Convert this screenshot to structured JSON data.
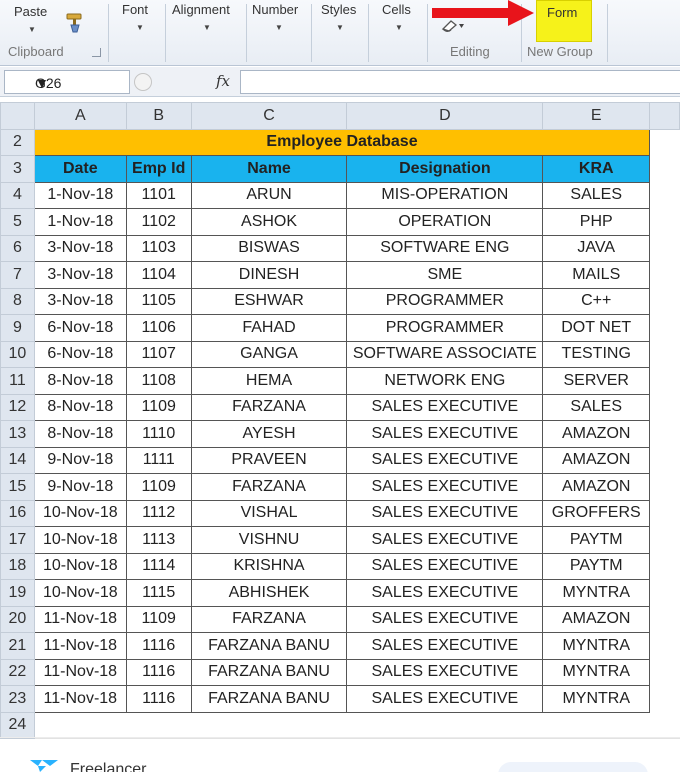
{
  "ribbon": {
    "paste_label": "Paste",
    "font_label": "Font",
    "alignment_label": "Alignment",
    "number_label": "Number",
    "styles_label": "Styles",
    "cells_label": "Cells",
    "clipboard_group": "Clipboard",
    "editing_group": "Editing",
    "form_label": "Form",
    "new_group": "New Group",
    "icons": [
      "format-painter-icon",
      "dialog-launcher-icon",
      "clear-icon",
      "red-arrow-icon"
    ],
    "arrow_color": "#e8141b",
    "form_highlight": "#f6f21a"
  },
  "formula_bar": {
    "cell_ref": "G26",
    "fx_label": "fx",
    "value": ""
  },
  "sheet": {
    "columns": [
      "A",
      "B",
      "C",
      "D",
      "E"
    ],
    "title_row_num": "2",
    "title": "Employee Database",
    "header_row_num": "3",
    "headers": [
      "Date",
      "Emp Id",
      "Name",
      "Designation",
      "KRA"
    ],
    "rows": [
      {
        "num": "4",
        "cells": [
          "1-Nov-18",
          "1101",
          "ARUN",
          "MIS-OPERATION",
          "SALES"
        ]
      },
      {
        "num": "5",
        "cells": [
          "1-Nov-18",
          "1102",
          "ASHOK",
          "OPERATION",
          "PHP"
        ]
      },
      {
        "num": "6",
        "cells": [
          "3-Nov-18",
          "1103",
          "BISWAS",
          "SOFTWARE ENG",
          "JAVA"
        ]
      },
      {
        "num": "7",
        "cells": [
          "3-Nov-18",
          "1104",
          "DINESH",
          "SME",
          "MAILS"
        ]
      },
      {
        "num": "8",
        "cells": [
          "3-Nov-18",
          "1105",
          "ESHWAR",
          "PROGRAMMER",
          "C++"
        ]
      },
      {
        "num": "9",
        "cells": [
          "6-Nov-18",
          "1106",
          "FAHAD",
          "PROGRAMMER",
          "DOT NET"
        ]
      },
      {
        "num": "10",
        "cells": [
          "6-Nov-18",
          "1107",
          "GANGA",
          "SOFTWARE ASSOCIATE",
          "TESTING"
        ]
      },
      {
        "num": "11",
        "cells": [
          "8-Nov-18",
          "1108",
          "HEMA",
          "NETWORK ENG",
          "SERVER"
        ]
      },
      {
        "num": "12",
        "cells": [
          "8-Nov-18",
          "1109",
          "FARZANA",
          "SALES EXECUTIVE",
          "SALES"
        ]
      },
      {
        "num": "13",
        "cells": [
          "8-Nov-18",
          "1110",
          "AYESH",
          "SALES EXECUTIVE",
          "AMAZON"
        ]
      },
      {
        "num": "14",
        "cells": [
          "9-Nov-18",
          "1111",
          "PRAVEEN",
          "SALES EXECUTIVE",
          "AMAZON"
        ]
      },
      {
        "num": "15",
        "cells": [
          "9-Nov-18",
          "1109",
          "FARZANA",
          "SALES EXECUTIVE",
          "AMAZON"
        ]
      },
      {
        "num": "16",
        "cells": [
          "10-Nov-18",
          "1112",
          "VISHAL",
          "SALES EXECUTIVE",
          "GROFFERS"
        ]
      },
      {
        "num": "17",
        "cells": [
          "10-Nov-18",
          "1113",
          "VISHNU",
          "SALES EXECUTIVE",
          "PAYTM"
        ]
      },
      {
        "num": "18",
        "cells": [
          "10-Nov-18",
          "1114",
          "KRISHNA",
          "SALES EXECUTIVE",
          "PAYTM"
        ]
      },
      {
        "num": "19",
        "cells": [
          "10-Nov-18",
          "1115",
          "ABHISHEK",
          "SALES EXECUTIVE",
          "MYNTRA"
        ]
      },
      {
        "num": "20",
        "cells": [
          "11-Nov-18",
          "1109",
          "FARZANA",
          "SALES EXECUTIVE",
          "AMAZON"
        ]
      },
      {
        "num": "21",
        "cells": [
          "11-Nov-18",
          "1116",
          "FARZANA BANU",
          "SALES EXECUTIVE",
          "MYNTRA"
        ]
      },
      {
        "num": "22",
        "cells": [
          "11-Nov-18",
          "1116",
          "FARZANA BANU",
          "SALES EXECUTIVE",
          "MYNTRA"
        ]
      },
      {
        "num": "23",
        "cells": [
          "11-Nov-18",
          "1116",
          "FARZANA BANU",
          "SALES EXECUTIVE",
          "MYNTRA"
        ]
      }
    ],
    "empty_row_num": "24",
    "title_color": "#ffbf00",
    "header_color": "#19b3ee"
  },
  "footer": {
    "brand": "Freelancer",
    "icons": [
      "freelancer-logo-icon"
    ]
  }
}
